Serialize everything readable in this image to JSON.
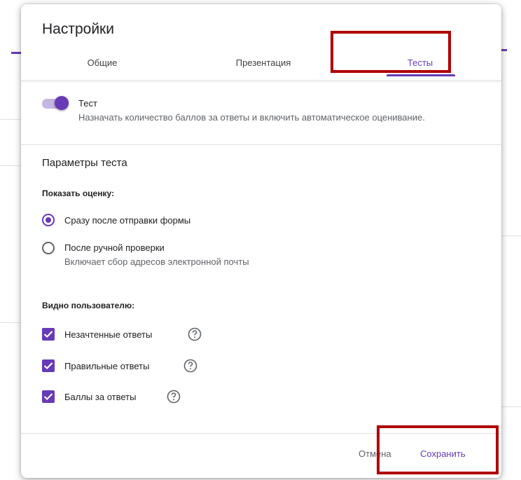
{
  "dialog": {
    "title": "Настройки",
    "tabs": [
      {
        "label": "Общие"
      },
      {
        "label": "Презентация"
      },
      {
        "label": "Тесты",
        "active": true
      }
    ]
  },
  "quiz_toggle": {
    "label": "Тест",
    "description": "Назначать количество баллов за ответы и включить автоматическое оценивание.",
    "on": true
  },
  "params": {
    "title": "Параметры теста",
    "show_grade": {
      "title": "Показать оценку:",
      "options": [
        {
          "label": "Сразу после отправки формы",
          "selected": true
        },
        {
          "label": "После ручной проверки",
          "sub": "Включает сбор адресов электронной почты",
          "selected": false
        }
      ]
    },
    "visible_to_user": {
      "title": "Видно пользователю:",
      "items": [
        {
          "label": "Незачтенные ответы",
          "checked": true
        },
        {
          "label": "Правильные ответы",
          "checked": true
        },
        {
          "label": "Баллы за ответы",
          "checked": true
        }
      ]
    }
  },
  "footer": {
    "cancel_label": "Отмена",
    "save_label": "Сохранить"
  },
  "colors": {
    "accent": "#673ab7",
    "highlight": "#b00000"
  }
}
